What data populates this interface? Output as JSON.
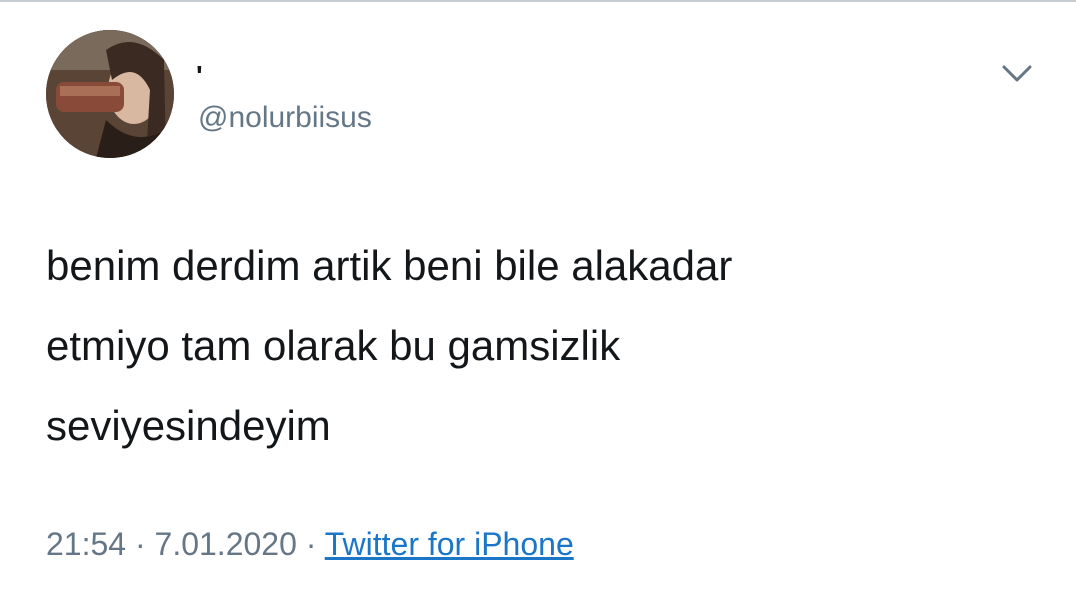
{
  "tweet": {
    "display_name": "'",
    "handle": "@nolurbiisus",
    "text_lines": [
      "benim derdim artik beni bile alakadar",
      "etmiyo tam olarak bu gamsizlik",
      "seviyesindeyim"
    ],
    "time": "21:54",
    "separator": "·",
    "date": "7.01.2020",
    "source": "Twitter for iPhone"
  },
  "icons": {
    "menu": "chevron-down-icon",
    "avatar": "profile-photo"
  },
  "colors": {
    "text": "#14171a",
    "secondary": "#657786",
    "link": "#1b76c8"
  }
}
